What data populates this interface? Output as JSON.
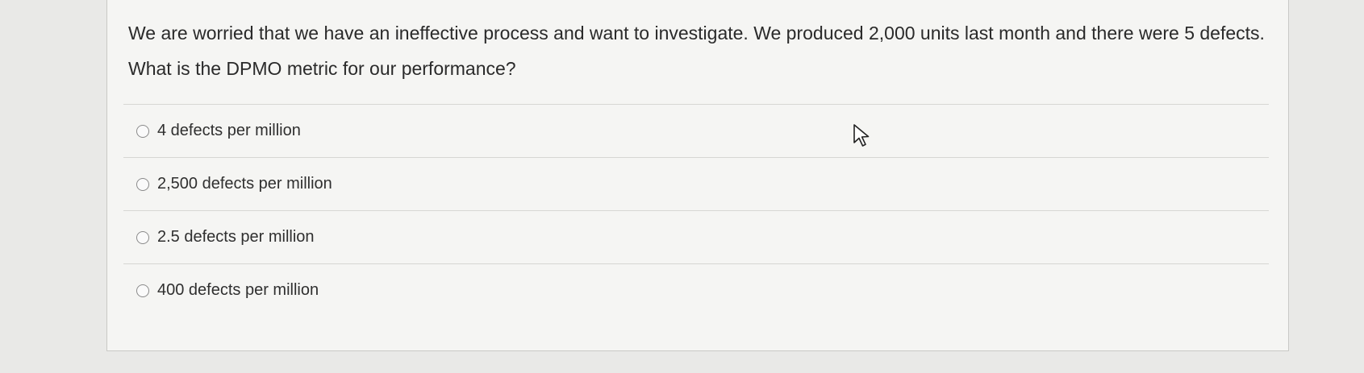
{
  "question": {
    "text": "We are worried that we have an ineffective process and want to investigate. We produced 2,000 units last month and there were 5 defects. What is the DPMO metric for our performance?"
  },
  "options": [
    {
      "label": "4 defects per million",
      "selected": false
    },
    {
      "label": "2,500 defects per million",
      "selected": false
    },
    {
      "label": "2.5 defects per million",
      "selected": false
    },
    {
      "label": "400 defects per million",
      "selected": false
    }
  ],
  "cursor": {
    "icon": "mouse-pointer-icon"
  }
}
